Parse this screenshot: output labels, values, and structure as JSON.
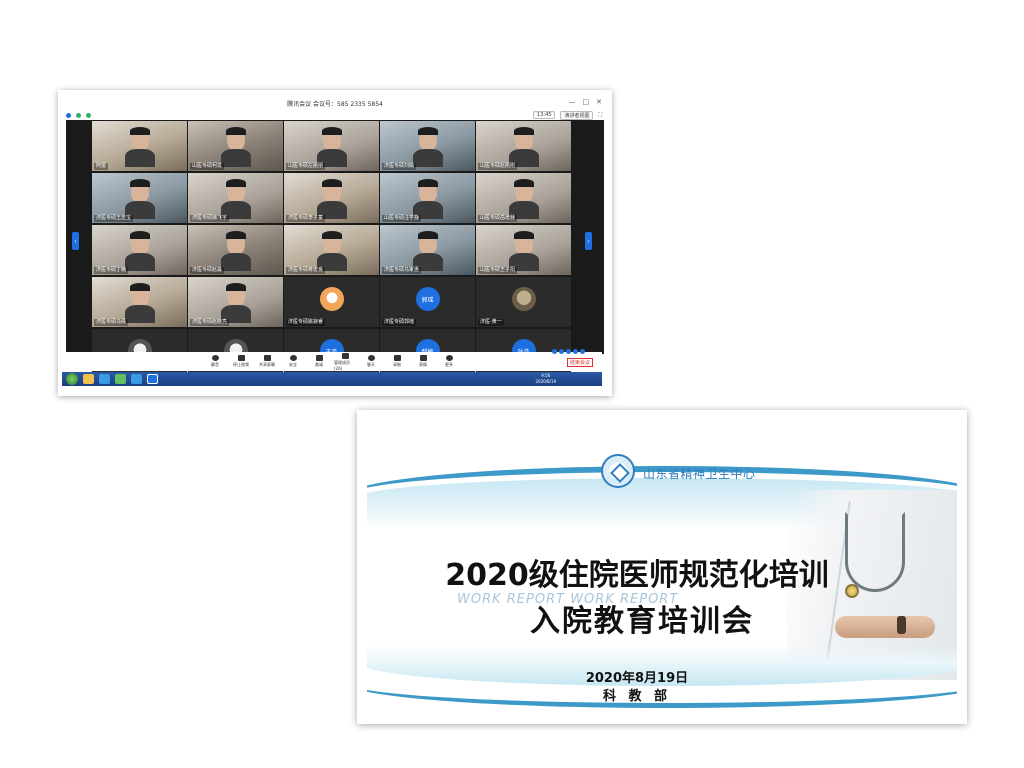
{
  "meeting": {
    "title": "腾讯会议 会议号：585 2335 5854",
    "window_controls": [
      "—",
      "□",
      "✕"
    ],
    "clock": "13:45",
    "speaker_view_label": "演讲者视图",
    "speaking_label": "正在讲话：",
    "participants": [
      {
        "name": "阿雷",
        "kind": "video",
        "tone": "v4"
      },
      {
        "name": "山医专硕柯龙",
        "kind": "video",
        "tone": "v1"
      },
      {
        "name": "山医专硕左朋朋",
        "kind": "video",
        "tone": "v2"
      },
      {
        "name": "济医专硕刘娟",
        "kind": "video",
        "tone": "v3"
      },
      {
        "name": "山医专硕赵刚刚",
        "kind": "video",
        "tone": "v2"
      },
      {
        "name": "济医专硕王志宝",
        "kind": "video",
        "tone": "v3"
      },
      {
        "name": "济医专硕徐飞宇",
        "kind": "video",
        "tone": "v2"
      },
      {
        "name": "济医专硕李子童",
        "kind": "video",
        "tone": "v4"
      },
      {
        "name": "山医专硕汪学静",
        "kind": "video",
        "tone": "v3"
      },
      {
        "name": "山医专硕岳增赫",
        "kind": "video",
        "tone": "v2"
      },
      {
        "name": "济医专硕丁楠",
        "kind": "video",
        "tone": "v2"
      },
      {
        "name": "济医专硕赵淼",
        "kind": "video",
        "tone": "v1"
      },
      {
        "name": "济医专硕蒋忠良",
        "kind": "video",
        "tone": "v4"
      },
      {
        "name": "济医专硕马家惠",
        "kind": "video",
        "tone": "v3"
      },
      {
        "name": "山医专硕王子阳",
        "kind": "video",
        "tone": "v2"
      },
      {
        "name": "济医专硕马倩",
        "kind": "video",
        "tone": "v4"
      },
      {
        "name": "济医专硕赵晓亮",
        "kind": "video",
        "tone": "v2"
      },
      {
        "name": "济医专硕姚寂睿",
        "kind": "avatar",
        "avatar": "",
        "style": "pic"
      },
      {
        "name": "济医专硕郭瑶",
        "kind": "avatar",
        "avatar": "郭瑶",
        "style": ""
      },
      {
        "name": "济医-黄一",
        "kind": "avatar",
        "avatar": "",
        "style": "pic2"
      },
      {
        "name": "",
        "kind": "avatar",
        "avatar": "",
        "style": "pic3"
      },
      {
        "name": "",
        "kind": "avatar",
        "avatar": "",
        "style": "pic3"
      },
      {
        "name": "",
        "kind": "avatar",
        "avatar": "王淼",
        "style": ""
      },
      {
        "name": "",
        "kind": "avatar",
        "avatar": "帮敏",
        "style": ""
      },
      {
        "name": "",
        "kind": "avatar",
        "avatar": "孙浩",
        "style": ""
      }
    ],
    "toolbar": [
      {
        "label": "静音",
        "icon": "microphone-icon"
      },
      {
        "label": "停止视频",
        "icon": "camera-icon"
      },
      {
        "label": "共享屏幕",
        "icon": "share-screen-icon"
      },
      {
        "label": "安全",
        "icon": "shield-icon"
      },
      {
        "label": "邀请",
        "icon": "invite-icon"
      },
      {
        "label": "管理成员(26)",
        "icon": "members-icon"
      },
      {
        "label": "聊天",
        "icon": "chat-icon"
      },
      {
        "label": "录制",
        "icon": "record-icon"
      },
      {
        "label": "表情",
        "icon": "emoji-icon"
      },
      {
        "label": "更多",
        "icon": "more-icon"
      }
    ],
    "end_label": "结束会议",
    "taskbar_time": "9:56",
    "taskbar_date": "2020/8/19"
  },
  "slide": {
    "org_name": "山东省精神卫生中心",
    "watermark": "WORK REPORT WORK REPORT",
    "title_line1": "2020级住院医师规范化培训",
    "title_line2": "入院教育培训会",
    "date": "2020年8月19日",
    "department": "科 教 部"
  },
  "colors": {
    "tencent_blue": "#1e6fe0",
    "slide_accent": "#3d9ac8",
    "org_blue": "#2f7ec0"
  }
}
